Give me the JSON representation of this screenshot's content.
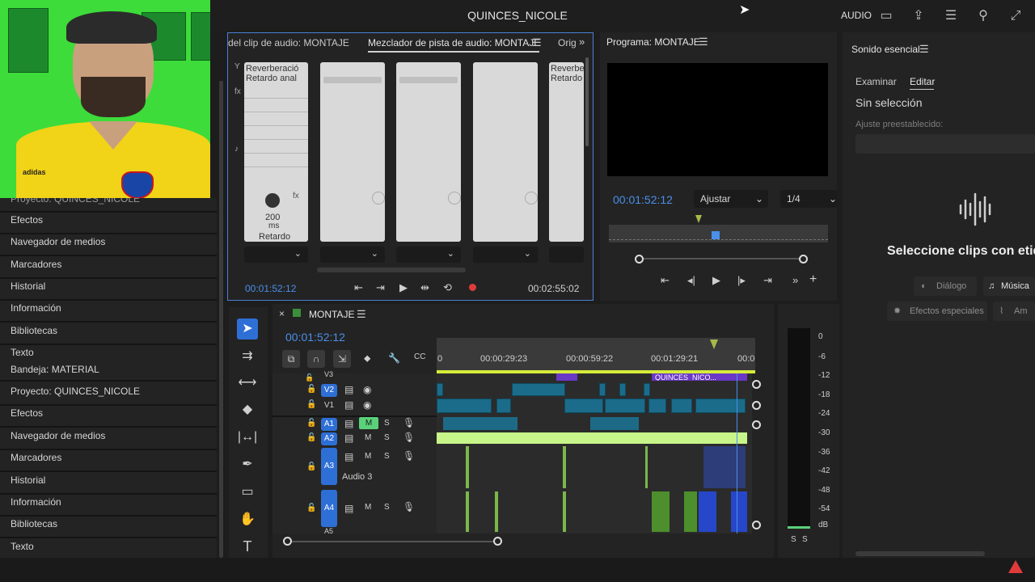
{
  "header": {
    "title": "QUINCES_NICOLE",
    "workspace": "AUDIO",
    "icons": [
      "panel-icon",
      "export-icon",
      "menu-icon",
      "search-icon",
      "fullscreen-icon"
    ]
  },
  "left_panel": {
    "group1": [
      "Proyecto: QUINCES_NICOLE",
      "Efectos",
      "Navegador de medios",
      "Marcadores",
      "Historial",
      "Información",
      "Bibliotecas",
      "Texto"
    ],
    "group2": [
      "Bandeja: MATERIAL",
      "Proyecto: QUINCES_NICOLE",
      "Efectos",
      "Navegador de medios",
      "Marcadores",
      "Historial",
      "Información",
      "Bibliotecas",
      "Texto"
    ]
  },
  "mixer": {
    "tab_clip": "del clip de audio: MONTAJE",
    "tab_track": "Mezclador de pista de audio: MONTAJE",
    "tab_orig": "Orig",
    "effect1": "Reverberació",
    "effect2": "Retardo anal",
    "effect3": "Reverbe",
    "effect4": "Retardo",
    "knob_value": "200",
    "knob_unit": "ms",
    "knob_param": "Retardo",
    "fx_label": "fx",
    "tc_in": "00:01:52:12",
    "tc_out": "00:02:55:02"
  },
  "program": {
    "title": "Programa: MONTAJE",
    "timecode": "00:01:52:12",
    "fit": "Ajustar",
    "resolution": "1/4"
  },
  "essential": {
    "title": "Sonido esencial",
    "tab_browse": "Examinar",
    "tab_edit": "Editar",
    "no_selection": "Sin selección",
    "preset_label": "Ajuste preestablecido:",
    "prompt": "Seleccione clips con etiq",
    "btn_dialog": "Diálogo",
    "btn_music": "Música",
    "btn_sfx": "Efectos especiales",
    "btn_amb": "Am"
  },
  "timeline": {
    "sequence": "MONTAJE",
    "timecode": "00:01:52:12",
    "ruler": [
      "0",
      "00:00:29:23",
      "00:00:59:22",
      "00:01:29:21",
      "00:0"
    ],
    "clip_name": "QUINCES_NICO...",
    "tracks": [
      "V3",
      "V2",
      "V1",
      "A1",
      "A2",
      "A3",
      "A4",
      "A5"
    ],
    "a3_name": "Audio 3",
    "m": "M",
    "s": "S"
  },
  "meter": {
    "ticks": [
      "0",
      "-6",
      "-12",
      "-18",
      "-24",
      "-30",
      "-36",
      "-42",
      "-48",
      "-54",
      "dB"
    ],
    "solo1": "S",
    "solo2": "S"
  },
  "colors": {
    "accent_blue": "#4a8fe8",
    "video_clip": "#1b6c8a",
    "audio_wave": "#c8f58a",
    "warning": "#e03b3b"
  }
}
